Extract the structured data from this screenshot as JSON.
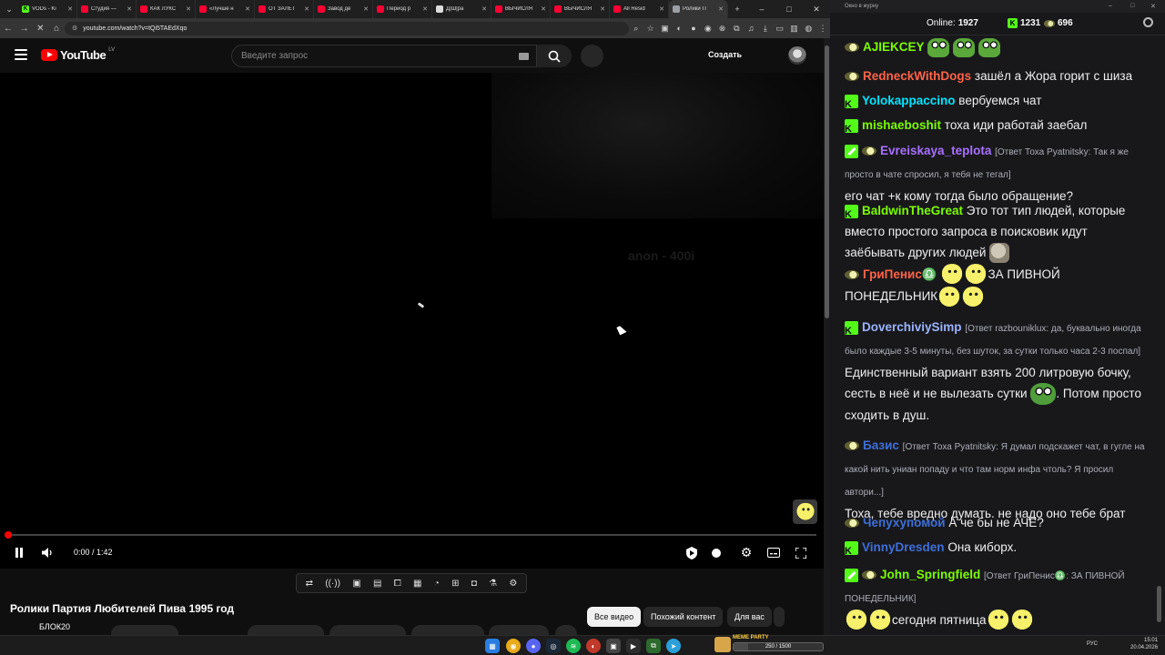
{
  "browser": {
    "tabs": [
      {
        "label": "VODs - Ki",
        "color": "#53fc18",
        "glyph": "K"
      },
      {
        "label": "Студия —",
        "color": "#ff0033",
        "glyph": ""
      },
      {
        "label": "КАК ЛУКС",
        "color": "#ff0033",
        "glyph": ""
      },
      {
        "label": "«Лучше н",
        "color": "#ff0033",
        "glyph": ""
      },
      {
        "label": "ОТ ЗАЛЕТ",
        "color": "#ff0033",
        "glyph": ""
      },
      {
        "label": "Завод де",
        "color": "#ff0033",
        "glyph": ""
      },
      {
        "label": "Период р",
        "color": "#ff0033",
        "glyph": ""
      },
      {
        "label": "Д|Ш|ра",
        "color": "#dcdcdc",
        "glyph": ""
      },
      {
        "label": "ВЫЧИСЛЯ",
        "color": "#ff0033",
        "glyph": ""
      },
      {
        "label": "ВЫЧИСЛЯ",
        "color": "#ff0033",
        "glyph": ""
      },
      {
        "label": "All Resid",
        "color": "#ff0033",
        "glyph": ""
      },
      {
        "label": "Ролики П",
        "color": "#9aa0a6",
        "glyph": ""
      }
    ],
    "url": "youtube.com/watch?v=tQi5TAEdXqo"
  },
  "youtube": {
    "logo_text": "YouTube",
    "logo_region": "LV",
    "search_placeholder": "Введите запрос",
    "create_label": "Создать",
    "ghost_overlay_text": "anon - 400i",
    "time_display": "0:00 / 1:42",
    "progress": 0.0,
    "video_title": "Ролики Партия Любителей Пива 1995 год",
    "channel": "БЛОК20",
    "pills": [
      "Все видео",
      "Похожий контент",
      "Для вас"
    ],
    "ext_toolbar_icons": [
      "repeat-icon",
      "broadcast-icon",
      "screen-icon",
      "clapper-icon",
      "aspect-icon",
      "film-strip-icon",
      "speedometer-icon",
      "plus-screen-icon",
      "camera-icon",
      "flask-icon",
      "gear-icon"
    ]
  },
  "chat": {
    "window_title": "Окно в журну",
    "online_label": "Online:",
    "online_count": "1927",
    "kick_count": "1231",
    "pea_count": "696",
    "messages": [
      {
        "user": "AJIEKCEY",
        "color": "#7cfc00",
        "badges": [
          "pea"
        ],
        "text": "",
        "reply": "",
        "emotes": [
          "frog",
          "frog",
          "frog"
        ]
      },
      {
        "user": "RedneckWithDogs",
        "color": "#ff6347",
        "badges": [
          "pea"
        ],
        "text": "зашёл а Жора горит с шиза",
        "reply": "",
        "emotes": []
      },
      {
        "user": "Yolokappaccino",
        "color": "#00e5ff",
        "badges": [
          "kick"
        ],
        "text": "вербуемся чат",
        "reply": "",
        "emotes": []
      },
      {
        "user": "mishaeboshit",
        "color": "#7cfc00",
        "badges": [
          "kick"
        ],
        "text": "тоха иди работай заебал",
        "reply": "",
        "emotes": []
      },
      {
        "user": "Evreiskaya_teplota",
        "color": "#a970ff",
        "badges": [
          "pencil",
          "pea"
        ],
        "text": "его чат +к кому тогда было обращение?",
        "reply": "[Ответ Тоха Pyatnitsky: Так я же просто в чате спросил, я тебя не тегал]",
        "emotes": []
      },
      {
        "user": "BaldwinTheGreat",
        "color": "#7cfc00",
        "badges": [
          "kick"
        ],
        "text": "Это тот тип людей, которые вместо простого запроса в поисковик идут заёбывать других людей",
        "reply": "",
        "emotes": [
          "stone"
        ]
      },
      {
        "user": "ГриПенис♎",
        "color": "#ff6347",
        "badges": [
          "pea"
        ],
        "text": "ЗА ПИВНОЙ ПОНЕДЕЛЬНИК",
        "reply": "",
        "emotes": [
          "chick",
          "chick",
          "chick",
          "chick"
        ]
      },
      {
        "user": "DoverchiviySimp",
        "color": "#9ab4ff",
        "badges": [
          "kick"
        ],
        "text": "Единственный вариант взять 200 литровую бочку, сесть в неё и не вылезать сутки",
        "text2": ". Потом просто сходить в душ.",
        "reply": "[Ответ razbouniklux: да, буквально иногда было каждые 3-5 минуты, без шуток, за сутки только часа 2-3 поспал]",
        "emotes": [
          "pepe"
        ]
      },
      {
        "user": "Базис",
        "color": "#3f6fd8",
        "badges": [
          "pea"
        ],
        "text": "Тоха, тебе вредно думать. не надо оно тебе брат",
        "reply": "[Ответ Тоха Pyatnitsky: Я думал подскажет чат, в гугле на какой нить униан попаду и что там норм инфа чтоль? Я просил автори...]",
        "emotes": []
      },
      {
        "user": "Чепухупомой",
        "color": "#3f6fd8",
        "badges": [
          "pea"
        ],
        "text": "А че бы не АЧЕ?",
        "reply": "",
        "emotes": []
      },
      {
        "user": "VinnyDresden",
        "color": "#3f6fd8",
        "badges": [
          "kick"
        ],
        "text": "Она киборх.",
        "reply": "",
        "emotes": []
      },
      {
        "user": "John_Springfield",
        "color": "#7cfc00",
        "badges": [
          "pencil",
          "pea"
        ],
        "text": "сегодня пятница",
        "reply": "[Ответ ГриПенис♎: ЗА ПИВНОЙ ПОНЕДЕЛЬНИК]",
        "emotes": [
          "chick",
          "chick",
          "chick",
          "chick"
        ]
      }
    ]
  },
  "taskbar": {
    "meme_party_label": "MEME PARTY",
    "meme_party_progress": "250 / 1500",
    "meme_party_fraction": 0.167,
    "lang": "РУС",
    "time": "15:01",
    "date": "20.04.2026"
  }
}
